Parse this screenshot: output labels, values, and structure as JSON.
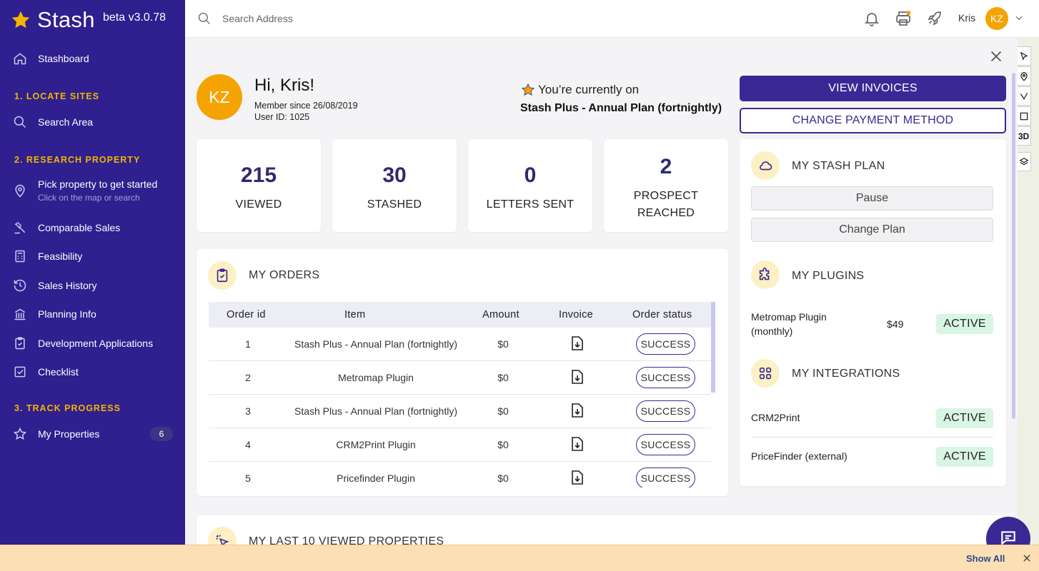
{
  "brand": {
    "name": "Stash",
    "version": "beta v3.0.78"
  },
  "sidebar": {
    "stashboard": "Stashboard",
    "section1": "1. LOCATE SITES",
    "search_area": "Search Area",
    "section2": "2. RESEARCH PROPERTY",
    "pick_property": "Pick property to get started",
    "pick_property_sub": "Click on the map or search",
    "comparable_sales": "Comparable Sales",
    "feasibility": "Feasibility",
    "sales_history": "Sales History",
    "planning_info": "Planning Info",
    "development_applications": "Development Applications",
    "checklist": "Checklist",
    "section3": "3. TRACK PROGRESS",
    "my_properties": "My Properties",
    "my_properties_count": "6"
  },
  "topbar": {
    "search_placeholder": "Search Address",
    "user_name": "Kris",
    "user_initials": "KZ"
  },
  "map_tools": {
    "three_d": "3D"
  },
  "profile": {
    "initials": "KZ",
    "greeting": "Hi, Kris!",
    "member_since": "Member since 26/08/2019",
    "user_id": "User ID: 1025",
    "plan_intro": "You’re currently on",
    "plan_name": "Stash Plus - Annual Plan (fortnightly)"
  },
  "actions": {
    "view_invoices": "VIEW INVOICES",
    "change_payment": "CHANGE PAYMENT METHOD"
  },
  "stats": [
    {
      "value": "215",
      "label": "VIEWED"
    },
    {
      "value": "30",
      "label": "STASHED"
    },
    {
      "value": "0",
      "label": "LETTERS SENT"
    },
    {
      "value": "2",
      "label": "PROSPECT REACHED",
      "label1": "PROSPECT",
      "label2": "REACHED"
    }
  ],
  "orders": {
    "title": "MY ORDERS",
    "columns": [
      "Order id",
      "Item",
      "Amount",
      "Invoice",
      "Order status"
    ],
    "rows": [
      {
        "id": "1",
        "item": "Stash Plus - Annual Plan (fortnightly)",
        "amount": "$0",
        "status": "SUCCESS"
      },
      {
        "id": "2",
        "item": "Metromap Plugin",
        "amount": "$0",
        "status": "SUCCESS"
      },
      {
        "id": "3",
        "item": "Stash Plus - Annual Plan (fortnightly)",
        "amount": "$0",
        "status": "SUCCESS"
      },
      {
        "id": "4",
        "item": "CRM2Print Plugin",
        "amount": "$0",
        "status": "SUCCESS"
      },
      {
        "id": "5",
        "item": "Pricefinder Plugin",
        "amount": "$0",
        "status": "SUCCESS"
      }
    ]
  },
  "stash_plan": {
    "title": "MY STASH PLAN",
    "pause": "Pause",
    "change_plan": "Change Plan"
  },
  "plugins": {
    "title": "MY PLUGINS",
    "items": [
      {
        "name": "Metromap Plugin",
        "name1": "Metromap Plugin",
        "name2": "(monthly)",
        "price": "$49",
        "status": "ACTIVE"
      }
    ]
  },
  "integrations": {
    "title": "MY INTEGRATIONS",
    "items": [
      {
        "name": "CRM2Print",
        "status": "ACTIVE"
      },
      {
        "name": "PriceFinder (external)",
        "status": "ACTIVE"
      }
    ]
  },
  "last_viewed": {
    "title": "MY LAST 10 VIEWED PROPERTIES"
  },
  "bottombar": {
    "show_all": "Show All"
  },
  "colors": {
    "sidebar": "#2f1f8f",
    "primary": "#3a2894",
    "accent": "#f4a300",
    "section": "#f4b400",
    "active_bg": "#d9f5e4"
  }
}
